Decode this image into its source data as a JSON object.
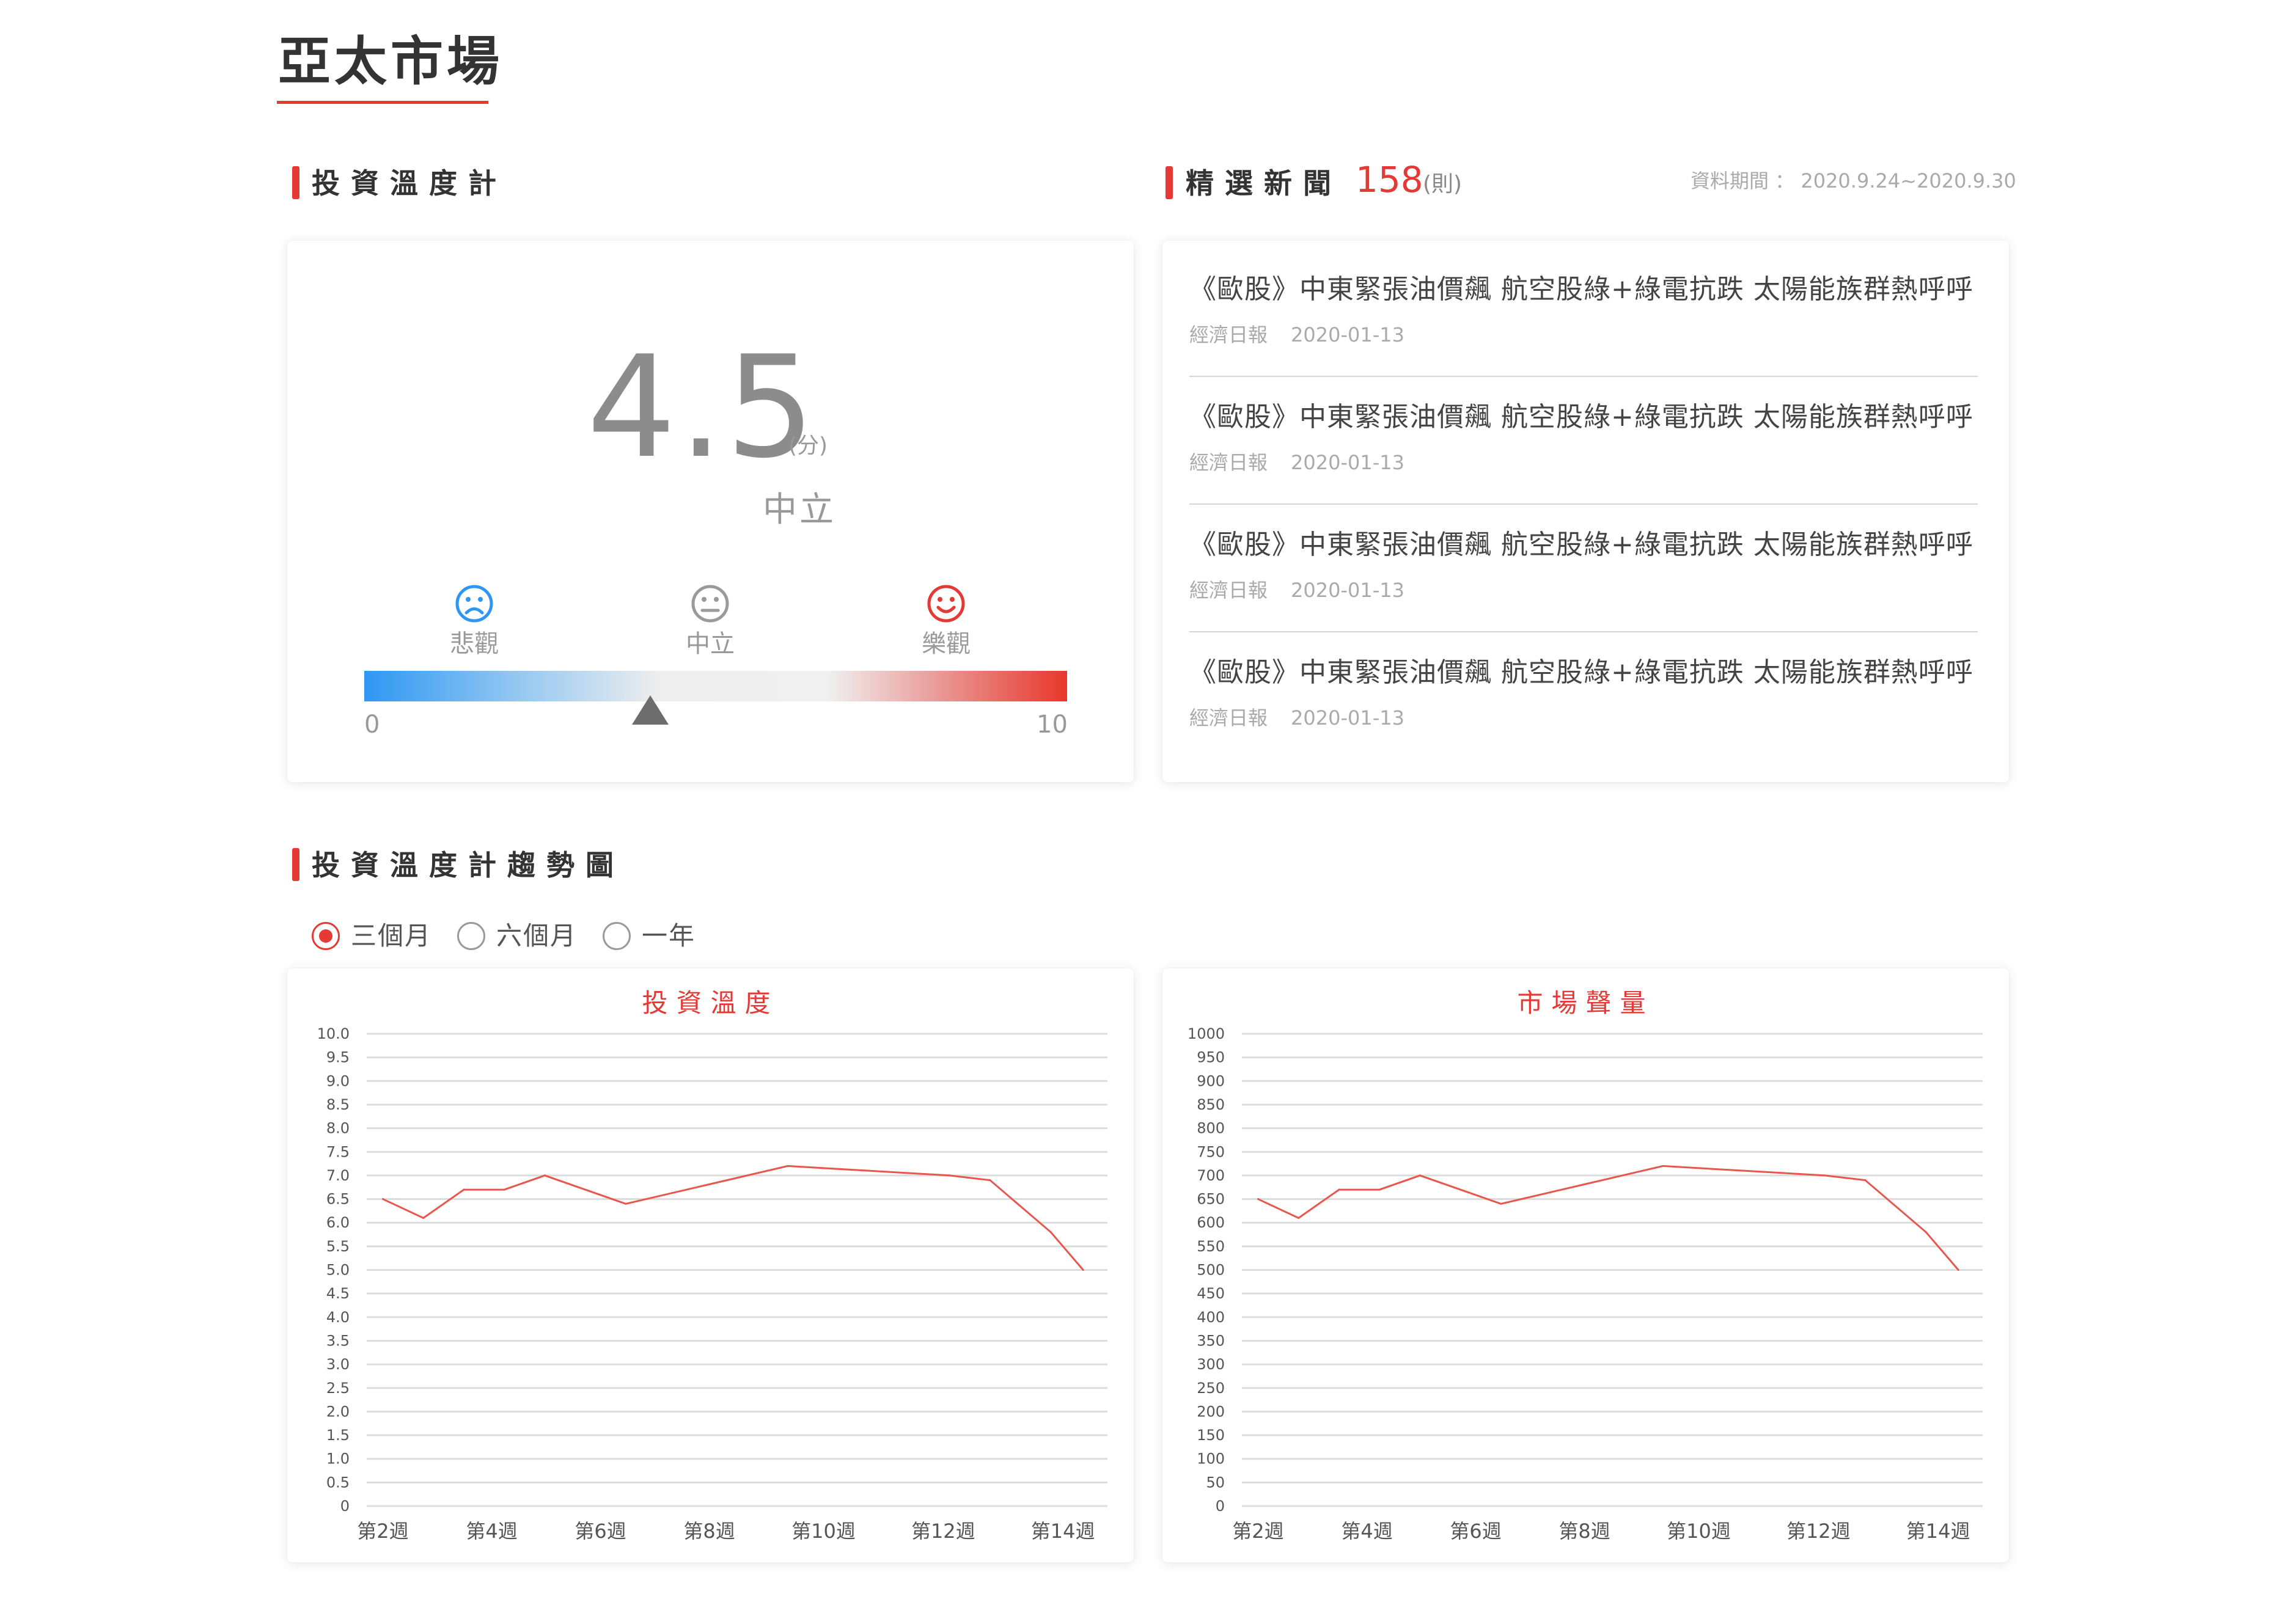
{
  "page_title": "亞太市場",
  "gauge_section": {
    "title": "投資溫度計",
    "score": "4.5",
    "unit": "(分)",
    "level": "中立",
    "moods": [
      {
        "label": "悲觀",
        "icon": "sad-face-icon",
        "color": "#2f97f3"
      },
      {
        "label": "中立",
        "icon": "neutral-face-icon",
        "color": "#999999"
      },
      {
        "label": "樂觀",
        "icon": "happy-face-icon",
        "color": "#e53935"
      }
    ],
    "scale_min": "0",
    "scale_max": "10",
    "pointer_value": 4.5
  },
  "news_section": {
    "title": "精選新聞",
    "count": "158",
    "count_unit": "(則)",
    "period": "資料期間 ： 2020.9.24~2020.9.30",
    "items": [
      {
        "headline": "《歐股》中東緊張油價飆 航空股綠+綠電抗跌 太陽能族群熱呼呼",
        "source": "經濟日報",
        "date": "2020-01-13"
      },
      {
        "headline": "《歐股》中東緊張油價飆 航空股綠+綠電抗跌 太陽能族群熱呼呼",
        "source": "經濟日報",
        "date": "2020-01-13"
      },
      {
        "headline": "《歐股》中東緊張油價飆 航空股綠+綠電抗跌 太陽能族群熱呼呼",
        "source": "經濟日報",
        "date": "2020-01-13"
      },
      {
        "headline": "《歐股》中東緊張油價飆 航空股綠+綠電抗跌 太陽能族群熱呼呼",
        "source": "經濟日報",
        "date": "2020-01-13"
      }
    ]
  },
  "trend_section": {
    "title": "投資溫度計趨勢圖",
    "ranges": [
      {
        "label": "三個月",
        "selected": true
      },
      {
        "label": "六個月",
        "selected": false
      },
      {
        "label": "一年",
        "selected": false
      }
    ]
  },
  "colors": {
    "accent": "#e53935",
    "line": "#e8574d"
  },
  "chart_data": [
    {
      "type": "line",
      "title": "投資溫度",
      "ylim": [
        0,
        10
      ],
      "y_ticks": [
        "0",
        "0.5",
        "1.0",
        "1.5",
        "2.0",
        "2.5",
        "3.0",
        "3.5",
        "4.0",
        "4.5",
        "5.0",
        "5.5",
        "6.0",
        "6.5",
        "7.0",
        "7.5",
        "8.0",
        "8.5",
        "9.0",
        "9.5",
        "10.0"
      ],
      "x_tick_labels": [
        "第2週",
        "第4週",
        "第6週",
        "第8週",
        "第10週",
        "第12週",
        "第14週"
      ],
      "x": [
        1,
        2,
        3,
        4,
        5,
        7,
        9,
        11,
        13,
        15,
        16,
        17.5,
        18.3
      ],
      "series": [
        {
          "values": [
            6.5,
            6.1,
            6.7,
            6.7,
            7.0,
            6.4,
            6.8,
            7.2,
            7.1,
            7.0,
            6.9,
            5.8,
            5.0
          ]
        }
      ],
      "grid": true
    },
    {
      "type": "line",
      "title": "市場聲量",
      "ylim": [
        0,
        1000
      ],
      "y_ticks": [
        "0",
        "50",
        "100",
        "150",
        "200",
        "250",
        "300",
        "350",
        "400",
        "450",
        "500",
        "550",
        "600",
        "650",
        "700",
        "750",
        "800",
        "850",
        "900",
        "950",
        "1000"
      ],
      "x_tick_labels": [
        "第2週",
        "第4週",
        "第6週",
        "第8週",
        "第10週",
        "第12週",
        "第14週"
      ],
      "x": [
        1,
        2,
        3,
        4,
        5,
        7,
        9,
        11,
        13,
        15,
        16,
        17.5,
        18.3
      ],
      "series": [
        {
          "values": [
            650,
            610,
            670,
            670,
            700,
            640,
            680,
            720,
            710,
            700,
            690,
            580,
            500
          ]
        }
      ],
      "grid": true
    }
  ]
}
